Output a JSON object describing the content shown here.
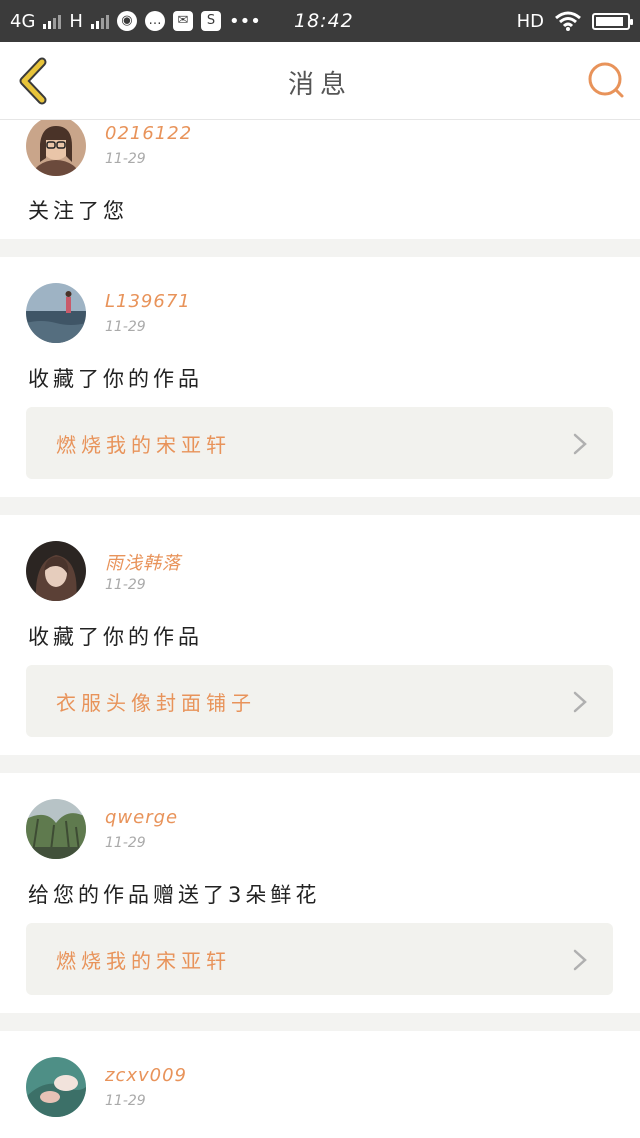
{
  "status_bar": {
    "network_1": "4G",
    "network_2": "H",
    "time": "18:42",
    "hd_label": "HD",
    "more_dots": "•••",
    "battery_level": 0.9
  },
  "nav": {
    "title": "消息",
    "accent_color": "#e8935a",
    "back_color": "#e8c43a"
  },
  "messages": [
    {
      "username": "0216122",
      "time": "11-29",
      "action": "关注了您",
      "work": ""
    },
    {
      "username": "L139671",
      "time": "11-29",
      "action": "收藏了你的作品",
      "work": "燃烧我的宋亚轩"
    },
    {
      "username": "雨浅韩落",
      "time": "11-29",
      "action": "收藏了你的作品",
      "work": "衣服头像封面铺子"
    },
    {
      "username": "qwerge",
      "time": "11-29",
      "action": "给您的作品赠送了3朵鲜花",
      "work": "燃烧我的宋亚轩"
    },
    {
      "username": "zcxv009",
      "time": "11-29",
      "action": "",
      "work": ""
    }
  ]
}
